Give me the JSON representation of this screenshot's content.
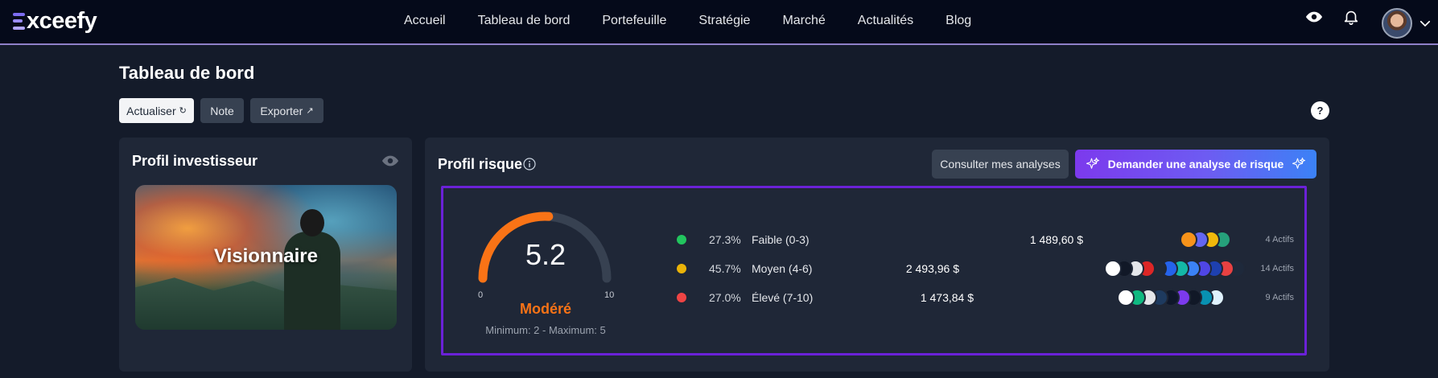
{
  "brand": {
    "name": "xceefy"
  },
  "nav": {
    "links": [
      "Accueil",
      "Tableau de bord",
      "Portefeuille",
      "Stratégie",
      "Marché",
      "Actualités",
      "Blog"
    ],
    "active_index": 1
  },
  "page": {
    "title": "Tableau de bord",
    "actions": {
      "refresh": "Actualiser",
      "note": "Note",
      "export": "Exporter"
    },
    "help": "?"
  },
  "investor_profile": {
    "title": "Profil investisseur",
    "profile_name": "Visionnaire"
  },
  "risk_profile": {
    "title": "Profil risque",
    "view_analyses_label": "Consulter mes analyses",
    "request_analysis_label": "Demander une analyse de risque",
    "score": "5.2",
    "score_value": 5.2,
    "scale_min": "0",
    "scale_max": "10",
    "level": "Modéré",
    "range_text": "Minimum: 2 - Maximum: 5",
    "gauge_color": "#f97316",
    "rows": [
      {
        "percent": "27.3%",
        "label": "Faible (0-3)",
        "amount": "1 489,60 $",
        "count": "4 Actifs",
        "dot_color": "#22c55e",
        "coins": [
          "#f7931a",
          "#6366f1",
          "#f0b90b",
          "#26a17b"
        ]
      },
      {
        "percent": "45.7%",
        "label": "Moyen (4-6)",
        "amount": "2 493,96 $",
        "count": "14 Actifs",
        "dot_color": "#eab308",
        "coins": [
          "#ffffff",
          "#111827",
          "#e5e7eb",
          "#dc2626",
          "#1f2937",
          "#2563eb",
          "#14b8a6",
          "#3b82f6",
          "#4f46e5",
          "#1e40af",
          "#e84142",
          "#1e293b"
        ]
      },
      {
        "percent": "27.0%",
        "label": "Élevé (7-10)",
        "amount": "1 473,84 $",
        "count": "9 Actifs",
        "dot_color": "#ef4444",
        "coins": [
          "#ffffff",
          "#10b981",
          "#e5e7eb",
          "#1e3a5f",
          "#0f172a",
          "#7c3aed",
          "#111827",
          "#0891b2",
          "#e0f2fe"
        ]
      }
    ]
  }
}
